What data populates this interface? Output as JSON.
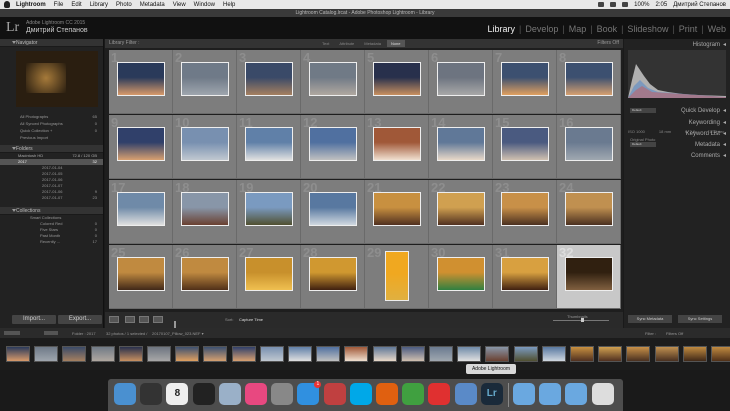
{
  "menubar": {
    "app": "Lightroom",
    "items": [
      "File",
      "Edit",
      "Library",
      "Photo",
      "Metadata",
      "View",
      "Window",
      "Help"
    ],
    "battery": "100%",
    "time": "2:05",
    "user": "Дмитрий Степанов"
  },
  "titlebar": {
    "title": "Lightroom Catalog.lrcat - Adobe Photoshop Lightroom - Library"
  },
  "identity": {
    "logo": "Lr",
    "catalog": "Adobe Lightroom CC 2015",
    "user": "Дмитрий Степанов"
  },
  "modules": [
    {
      "label": "Library",
      "active": true
    },
    {
      "label": "Develop"
    },
    {
      "label": "Map"
    },
    {
      "label": "Book"
    },
    {
      "label": "Slideshow"
    },
    {
      "label": "Print"
    },
    {
      "label": "Web"
    }
  ],
  "left": {
    "navigator": "Navigator",
    "catalog_items": [
      {
        "label": "All Photographs",
        "count": "65"
      },
      {
        "label": "All Synced Photographs",
        "count": "0"
      },
      {
        "label": "Quick Collection +",
        "count": "0"
      },
      {
        "label": "Previous Import",
        "count": ""
      }
    ],
    "folders_header": "Folders",
    "volume": {
      "label": "Macintosh HD",
      "info": "72.8 / 120 GB"
    },
    "folders": [
      {
        "label": "2017",
        "count": "32",
        "sel": true,
        "sub": false
      },
      {
        "label": "2017-01-04",
        "count": "",
        "sub": true
      },
      {
        "label": "2017-01-05",
        "count": "",
        "sub": true
      },
      {
        "label": "2017-01-06",
        "count": "",
        "sub": true
      },
      {
        "label": "2017-01-07",
        "count": "",
        "sub": true
      },
      {
        "label": "2017-01-06",
        "count": "9",
        "sub": true
      },
      {
        "label": "2017-01-07",
        "count": "23",
        "sub": true
      }
    ],
    "collections_header": "Collections",
    "collections": [
      {
        "label": "Smart Collections",
        "count": "",
        "sub": false
      },
      {
        "label": "Colored Red",
        "count": "0",
        "sub": true
      },
      {
        "label": "Five Stars",
        "count": "0",
        "sub": true
      },
      {
        "label": "Past Month",
        "count": "0",
        "sub": true
      },
      {
        "label": "Recently ...",
        "count": "17",
        "sub": true
      }
    ],
    "import": "Import...",
    "export": "Export..."
  },
  "center": {
    "filter_label": "Library Filter :",
    "filter_tabs": [
      "Text",
      "Attribute",
      "Metadata",
      "None"
    ],
    "filter_active": "None",
    "filter_off": "Filters Off",
    "cells": [
      {
        "n": "1",
        "c": [
          "#2a3a5a",
          "#d89a6a"
        ]
      },
      {
        "n": "2",
        "c": [
          "#6f7a88",
          "#9fa6ae"
        ]
      },
      {
        "n": "3",
        "c": [
          "#3a4a68",
          "#a58060"
        ]
      },
      {
        "n": "4",
        "c": [
          "#707a86",
          "#b0a8a0"
        ]
      },
      {
        "n": "5",
        "c": [
          "#28304c",
          "#c89060"
        ]
      },
      {
        "n": "6",
        "c": [
          "#6d7480",
          "#a8a8a8"
        ]
      },
      {
        "n": "7",
        "c": [
          "#3c5070",
          "#e0a060"
        ]
      },
      {
        "n": "8",
        "c": [
          "#3c5070",
          "#d6a070"
        ]
      },
      {
        "n": "9",
        "c": [
          "#30406a",
          "#d8a070"
        ]
      },
      {
        "n": "10",
        "c": [
          "#7890b0",
          "#c0c8d0"
        ]
      },
      {
        "n": "11",
        "c": [
          "#6080a8",
          "#e0e0e0"
        ]
      },
      {
        "n": "12",
        "c": [
          "#5070a0",
          "#c0c0c0"
        ]
      },
      {
        "n": "13",
        "c": [
          "#a05838",
          "#f0e0d0"
        ]
      },
      {
        "n": "14",
        "c": [
          "#607898",
          "#e8d8c8"
        ]
      },
      {
        "n": "15",
        "c": [
          "#4a5a80",
          "#d0c0b0"
        ]
      },
      {
        "n": "16",
        "c": [
          "#6a7a90",
          "#a0a8b0"
        ]
      },
      {
        "n": "17",
        "c": [
          "#6f8aa8",
          "#e0e0e0"
        ]
      },
      {
        "n": "18",
        "c": [
          "#8896a8",
          "#6a4030"
        ]
      },
      {
        "n": "19",
        "c": [
          "#7a9ac0",
          "#505030"
        ]
      },
      {
        "n": "20",
        "c": [
          "#5878a0",
          "#d0d8e0"
        ]
      },
      {
        "n": "21",
        "c": [
          "#c89040",
          "#503020"
        ]
      },
      {
        "n": "22",
        "c": [
          "#d0a050",
          "#503020"
        ]
      },
      {
        "n": "23",
        "c": [
          "#c89048",
          "#4a3020"
        ]
      },
      {
        "n": "24",
        "c": [
          "#c09050",
          "#4a3020"
        ]
      },
      {
        "n": "25",
        "c": [
          "#c08a40",
          "#402818"
        ]
      },
      {
        "n": "26",
        "c": [
          "#c08a40",
          "#503018"
        ]
      },
      {
        "n": "27",
        "c": [
          "#c8902c",
          "#f0c050"
        ]
      },
      {
        "n": "28",
        "c": [
          "#d09830",
          "#402010"
        ]
      },
      {
        "n": "29",
        "c": [
          "#f0a820",
          "#e0b040"
        ],
        "portrait": true
      },
      {
        "n": "30",
        "c": [
          "#d09030",
          "#308040"
        ]
      },
      {
        "n": "31",
        "c": [
          "#d8a040",
          "#402010"
        ]
      },
      {
        "n": "32",
        "c": [
          "#302010",
          "#806040"
        ],
        "sel": true
      }
    ],
    "sort_label": "Sort:",
    "sort_value": "Capture Time",
    "thumbnails_label": "Thumbnails"
  },
  "right": {
    "histogram": "Histogram",
    "hist_info": [
      "ISO 1000",
      "18 mm",
      "f / 2.8",
      "1/30 sec"
    ],
    "original": "Original Photo",
    "quick_develop": "Quick Develop",
    "qd_preset": "Default",
    "keywording": "Keywording",
    "keyword_list": "Keyword List",
    "metadata": "Metadata",
    "md_preset": "Default",
    "comments": "Comments",
    "sync_metadata": "Sync Metadata",
    "sync_settings": "Sync Settings"
  },
  "filmhead": {
    "folder": "Folder : 2017",
    "count": "32 photos / 1 selected /",
    "file": "20170107_Pillow_023.NEF ▾",
    "filter_label": "Filter :",
    "filter_value": "Filters Off"
  },
  "filmstrip": [
    "#2a3a5a",
    "#6f7a88",
    "#3a4a68",
    "#707a86",
    "#28304c",
    "#6d7480",
    "#3c5070",
    "#3c5070",
    "#30406a",
    "#7890b0",
    "#6080a8",
    "#5070a0",
    "#a05838",
    "#607898",
    "#4a5a80",
    "#6a7a90",
    "#6f8aa8",
    "#8896a8",
    "#7a9ac0",
    "#5878a0",
    "#c89040",
    "#d0a050",
    "#c89048",
    "#c09050",
    "#c08a40",
    "#c08a40",
    "#c8902c",
    "#d09830",
    "#f0a820",
    "#d09030",
    "#d8a040",
    "#302010"
  ],
  "dock": {
    "tooltip": "Adobe Lightroom",
    "icons": [
      {
        "name": "finder-icon",
        "c": "#4a90d0"
      },
      {
        "name": "launchpad-icon",
        "c": "#333"
      },
      {
        "name": "calendar-icon",
        "c": "#eee",
        "label": "8"
      },
      {
        "name": "dashboard-icon",
        "c": "#222"
      },
      {
        "name": "preview-icon",
        "c": "#9ab0c8"
      },
      {
        "name": "itunes-icon",
        "c": "#e84880"
      },
      {
        "name": "settings-icon",
        "c": "#888"
      },
      {
        "name": "appstore-icon",
        "c": "#3090e0",
        "badge": "1"
      },
      {
        "name": "photobooth-icon",
        "c": "#c04040"
      },
      {
        "name": "skype-icon",
        "c": "#00a8e8"
      },
      {
        "name": "firefox-icon",
        "c": "#e06010"
      },
      {
        "name": "chrome-icon",
        "c": "#40a040"
      },
      {
        "name": "yandex-icon",
        "c": "#e03030"
      },
      {
        "name": "screen-icon",
        "c": "#5a8ac8"
      },
      {
        "name": "lightroom-icon",
        "c": "#1a2a3a",
        "label": "Lr"
      },
      {
        "name": "folder-icon",
        "c": "#6aa8e0"
      },
      {
        "name": "downloads-folder-icon",
        "c": "#6aa8e0"
      },
      {
        "name": "documents-folder-icon",
        "c": "#6aa8e0"
      },
      {
        "name": "trash-icon",
        "c": "#ddd"
      }
    ]
  }
}
